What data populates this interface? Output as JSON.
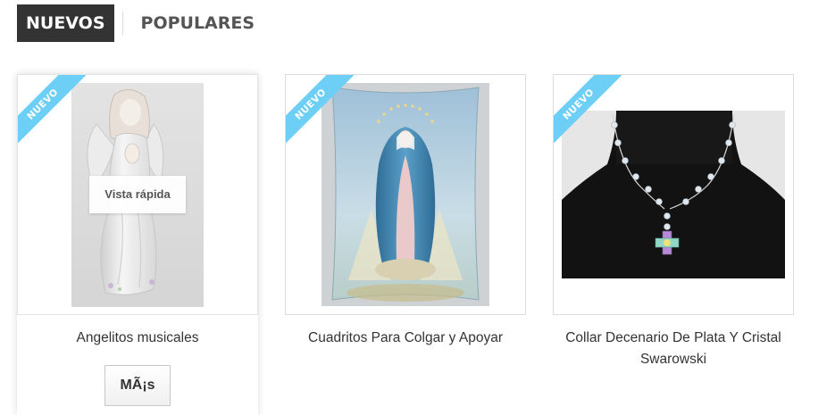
{
  "tabs": {
    "active_label": "NUEVOS",
    "inactive_label": "POPULARES"
  },
  "products": [
    {
      "name": "Angelitos musicales",
      "badge": "NUEVO",
      "quick_view": "Vista rápida",
      "more_button": "MÃ¡s"
    },
    {
      "name": "Cuadritos Para Colgar y Apoyar",
      "badge": "NUEVO"
    },
    {
      "name": "Collar Decenario De Plata Y Cristal Swarowski",
      "badge": "NUEVO"
    }
  ],
  "colors": {
    "ribbon": "#6dcff6",
    "active_tab_bg": "#333333",
    "border": "#dcdcdc"
  }
}
